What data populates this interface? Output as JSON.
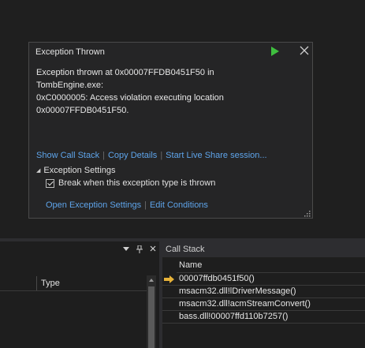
{
  "popup": {
    "title": "Exception Thrown",
    "message": "Exception thrown at 0x00007FFDB0451F50 in TombEngine.exe:\n0xC0000005: Access violation executing location\n0x00007FFDB0451F50.",
    "links": {
      "show_call_stack": "Show Call Stack",
      "copy_details": "Copy Details",
      "live_share": "Start Live Share session..."
    },
    "settings_header": "Exception Settings",
    "break_checkbox": {
      "label": "Break when this exception type is thrown",
      "checked": true
    },
    "links2": {
      "open_settings": "Open Exception Settings",
      "edit_conditions": "Edit Conditions"
    },
    "icons": {
      "continue": "play-icon",
      "close": "close-icon",
      "resize": "resize-grip-icon"
    },
    "colors": {
      "link": "#5ea4ea",
      "play": "#3fbf3f"
    }
  },
  "left_pane": {
    "column_type": "Type",
    "tools": [
      "dropdown-icon",
      "pin-icon",
      "close-icon"
    ]
  },
  "callstack": {
    "title": "Call Stack",
    "column_name": "Name",
    "rows": [
      {
        "label": "00007ffdb0451f50()",
        "current": true
      },
      {
        "label": "msacm32.dll!lDriverMessage()",
        "current": false
      },
      {
        "label": "msacm32.dll!acmStreamConvert()",
        "current": false
      },
      {
        "label": "bass.dll!00007ffd110b7257()",
        "current": false
      }
    ],
    "colors": {
      "current_arrow": "#e8b339"
    }
  }
}
